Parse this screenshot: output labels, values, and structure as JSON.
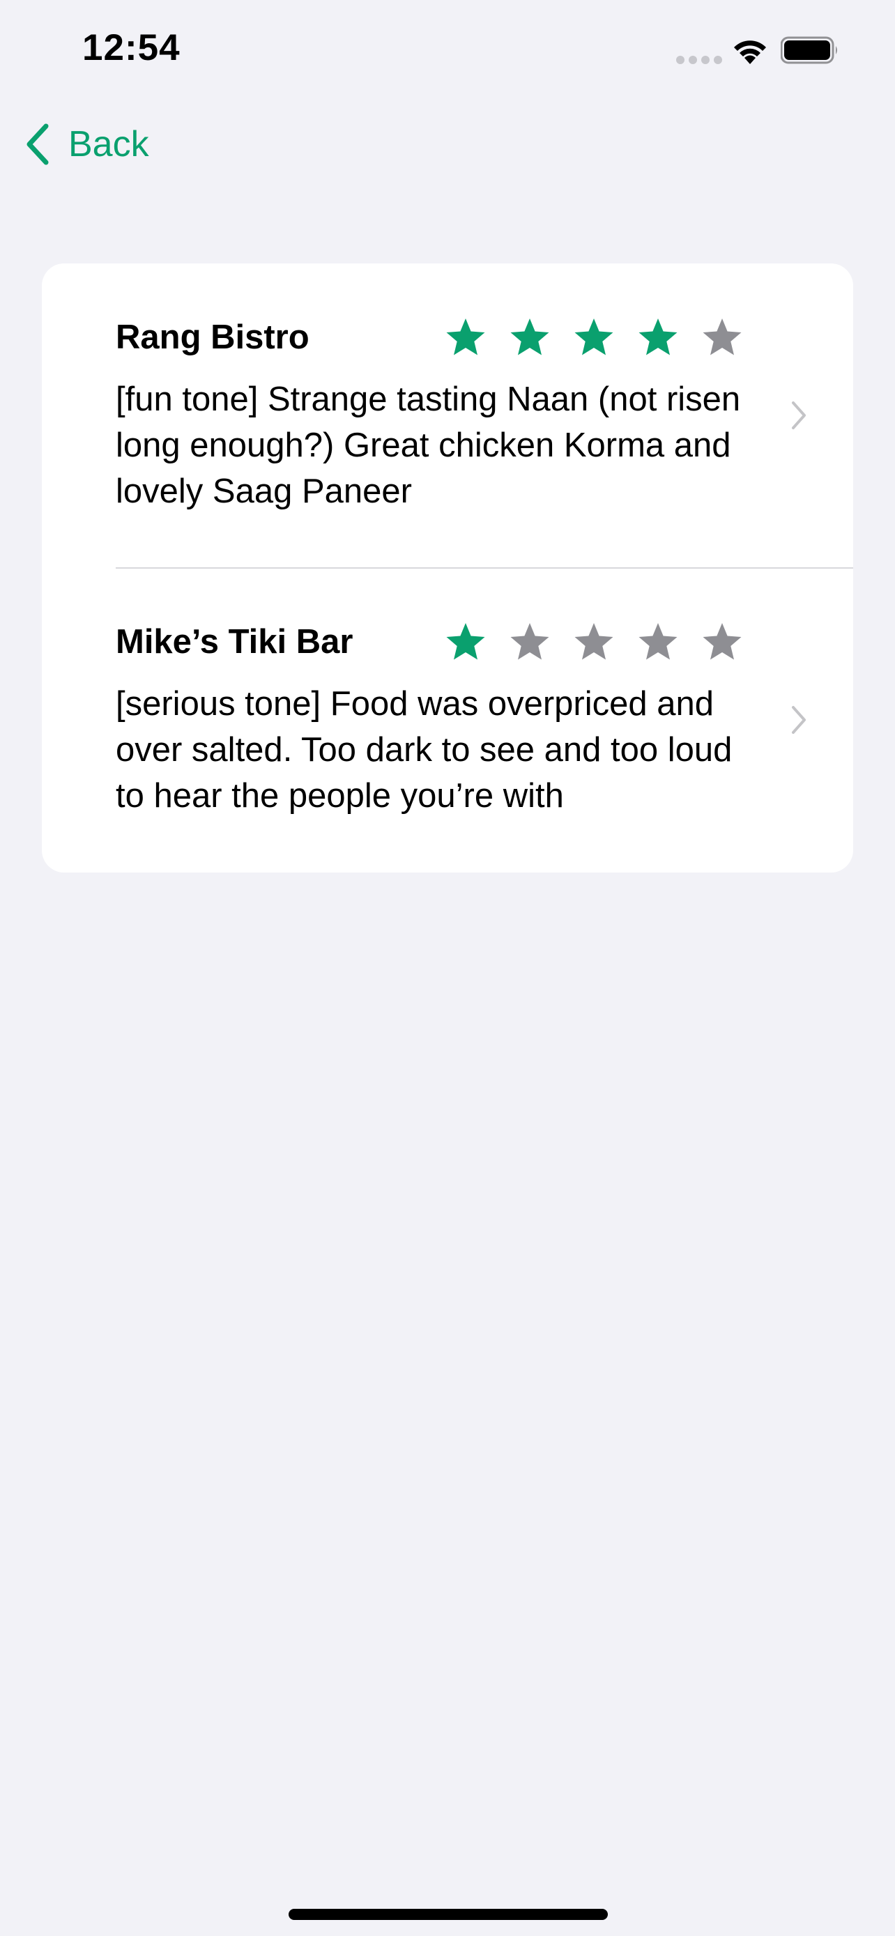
{
  "status_bar": {
    "time": "12:54"
  },
  "nav": {
    "back_label": "Back",
    "accent_color": "#0aa06e"
  },
  "reviews": [
    {
      "name": "Rang Bistro",
      "rating": 4,
      "max_rating": 5,
      "text": "[fun tone] Strange tasting Naan (not risen long enough?) Great chicken Korma and lovely Saag Paneer"
    },
    {
      "name": "Mike’s Tiki Bar",
      "rating": 1,
      "max_rating": 5,
      "text": "[serious tone] Food was overpriced and over salted. Too dark to see and too loud to hear the people you’re with"
    }
  ],
  "colors": {
    "star_filled": "#0aa06e",
    "star_empty": "#8e8e93",
    "background": "#f2f2f7"
  },
  "icons": {
    "back": "chevron-left-icon",
    "row_disclosure": "chevron-right-icon",
    "wifi": "wifi-icon",
    "battery": "battery-icon"
  }
}
